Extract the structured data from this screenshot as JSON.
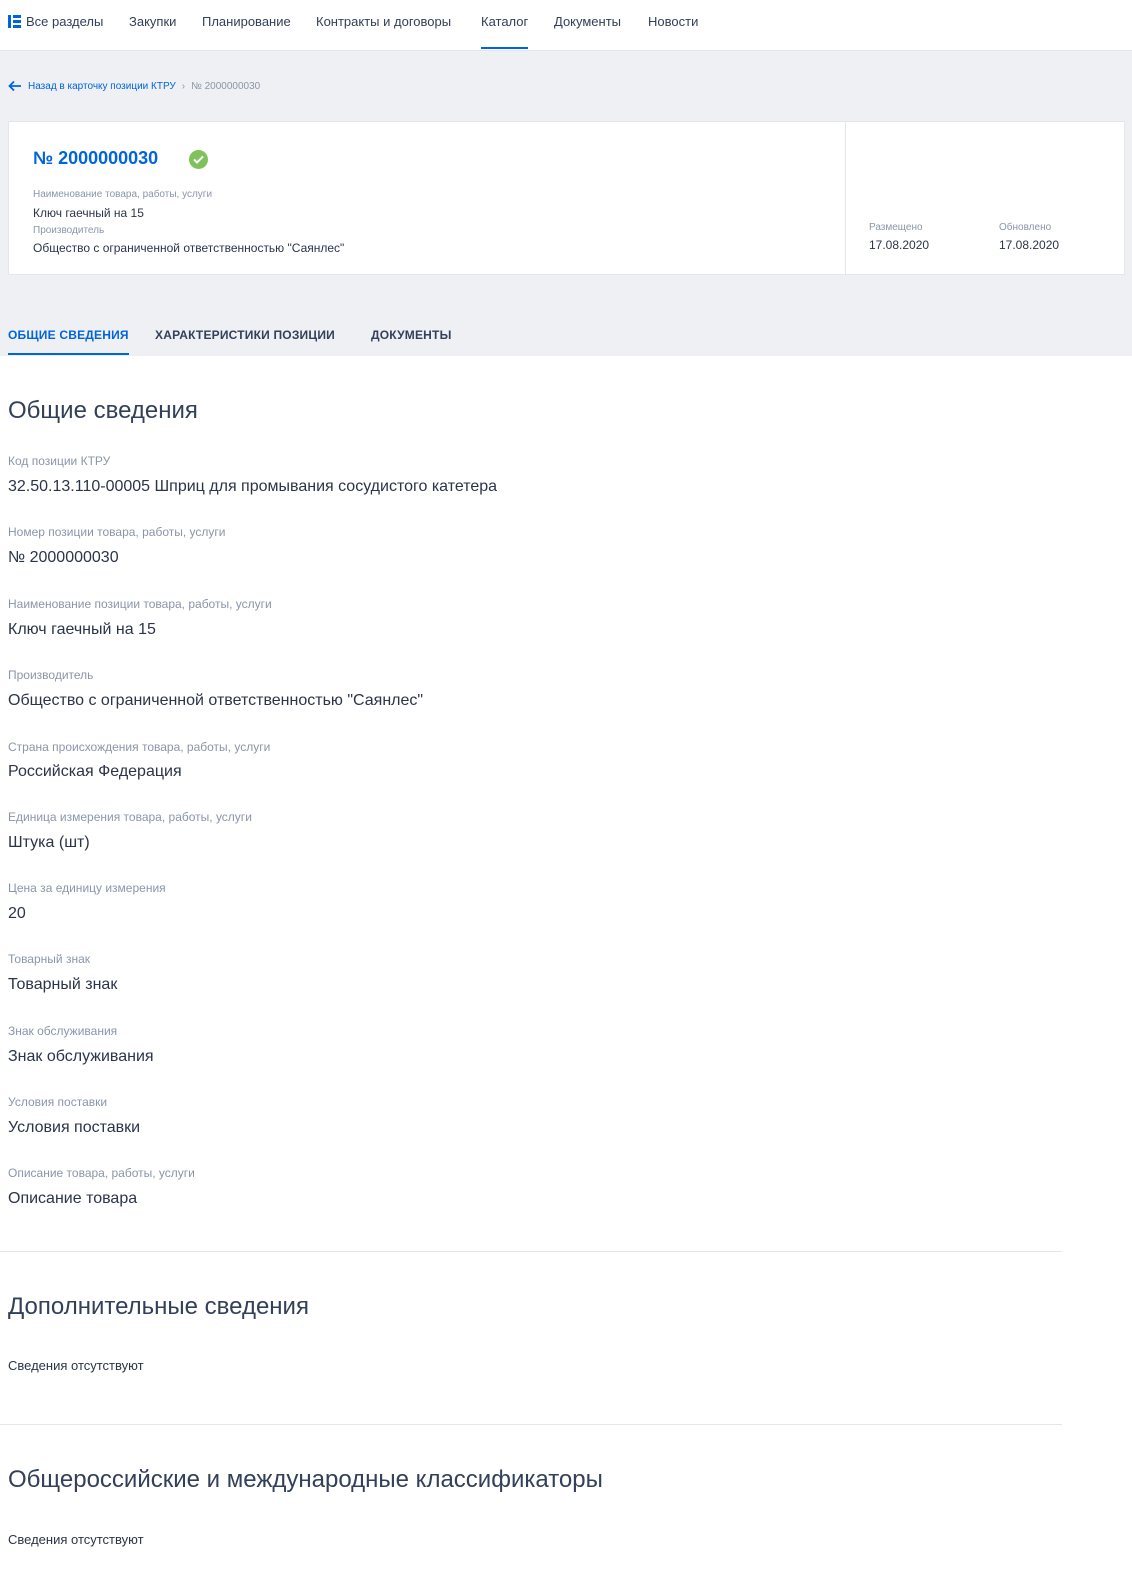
{
  "topnav": {
    "items": [
      "Все разделы",
      "Закупки",
      "Планирование",
      "Контракты и договоры",
      "Каталог",
      "Документы",
      "Новости"
    ],
    "active_index": 4
  },
  "breadcrumb": {
    "back": "Назад в карточку позиции КТРУ",
    "separator": "›",
    "current": "№ 2000000030"
  },
  "card": {
    "number": "№ 2000000030",
    "status_icon": "check-circle-icon",
    "status_color": "#7fc25c",
    "name_label": "Наименование товара, работы, услуги",
    "name_value": "Ключ гаечный на 15",
    "maker_label": "Производитель",
    "maker_value": "Общество с ограниченной ответственностью \"Саянлес\"",
    "placed_label": "Размещено",
    "placed_value": "17.08.2020",
    "updated_label": "Обновлено",
    "updated_value": "17.08.2020"
  },
  "tabs": [
    "ОБЩИЕ СВЕДЕНИЯ",
    "ХАРАКТЕРИСТИКИ ПОЗИЦИИ",
    "ДОКУМЕНТЫ"
  ],
  "general": {
    "title": "Общие сведения",
    "fields": [
      {
        "label": "Код позиции КТРУ",
        "value": "32.50.13.110-00005 Шприц для промывания сосудистого катетера"
      },
      {
        "label": "Номер позиции товара, работы, услуги",
        "value": "№ 2000000030"
      },
      {
        "label": "Наименование позиции товара, работы, услуги",
        "value": "Ключ гаечный на 15"
      },
      {
        "label": "Производитель",
        "value": "Общество с ограниченной ответственностью \"Саянлес\""
      },
      {
        "label": "Страна происхождения товара, работы, услуги",
        "value": "Российская Федерация"
      },
      {
        "label": "Единица измерения товара, работы, услуги",
        "value": "Штука (шт)"
      },
      {
        "label": "Цена за единицу измерения",
        "value": "20"
      },
      {
        "label": "Товарный знак",
        "value": "Товарный знак"
      },
      {
        "label": "Знак обслуживания",
        "value": "Знак обслуживания"
      },
      {
        "label": "Условия поставки",
        "value": "Условия поставки"
      },
      {
        "label": "Описание товара, работы, услуги",
        "value": "Описание товара"
      }
    ]
  },
  "additional": {
    "title": "Дополнительные сведения",
    "empty": "Сведения отсутствуют"
  },
  "classifiers": {
    "title": "Общероссийские и международные классификаторы",
    "empty": "Сведения отсутствуют"
  },
  "colors": {
    "accent": "#0065dd",
    "band": "#eef0f3",
    "muted": "#8a96a8"
  }
}
